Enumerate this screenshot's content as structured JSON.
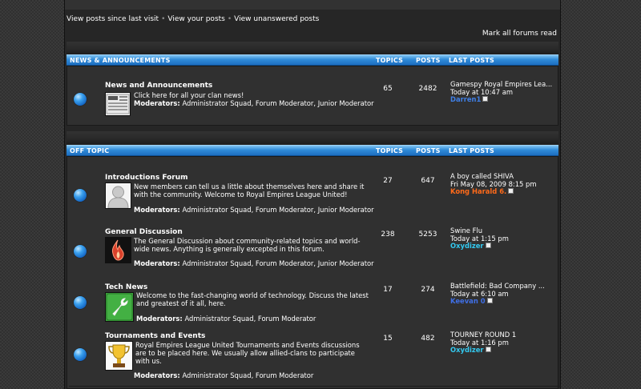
{
  "quicklinks": [
    "View posts since last visit",
    "View your posts",
    "View unanswered posts"
  ],
  "separator": "•",
  "mark_all": "Mark all forums read",
  "columns": {
    "topics": "TOPICS",
    "posts": "POSTS",
    "last_posts": "LAST POSTS"
  },
  "categories": [
    {
      "name": "NEWS & ANNOUNCEMENTS",
      "forums": [
        {
          "title": "News and Announcements",
          "desc": "Click here for all your clan news!",
          "mods_label": "Moderators:",
          "mods": "Administrator Squad, Forum Moderator, Junior Moderator",
          "topics": "65",
          "posts": "2482",
          "last_title": "Gamespy Royal Empires Lea...",
          "last_time": "Today at 10:47 am",
          "last_user": "Darren1",
          "last_user_color": "#3f7fe6",
          "icon": "newspaper-icon"
        }
      ]
    },
    {
      "name": "OFF TOPIC",
      "forums": [
        {
          "title": "Introductions Forum",
          "desc": "New members can tell us a little about themselves here and share it with the community. Welcome to Royal Empires League United!",
          "mods_label": "Moderators:",
          "mods": "Administrator Squad, Forum Moderator, Junior Moderator",
          "topics": "27",
          "posts": "647",
          "last_title": "A boy called SHIVA",
          "last_time": "Fri May 08, 2009 8:15 pm",
          "last_user": "Kong Harald 6.",
          "last_user_color": "#ff6a1a",
          "icon": "person-silhouette-icon"
        },
        {
          "title": "General Discussion",
          "desc": "The General Discussion about community-related topics and world-wide news. Anything is generally excepted in this forum.",
          "mods_label": "Moderators:",
          "mods": "Administrator Squad, Forum Moderator, Junior Moderator",
          "topics": "238",
          "posts": "5253",
          "last_title": "Swine Flu",
          "last_time": "Today at 1:15 pm",
          "last_user": "Oxydizer",
          "last_user_color": "#33c9f0",
          "icon": "flame-icon"
        },
        {
          "title": "Tech News",
          "desc": "Welcome to the fast-changing world of technology. Discuss the latest and greatest of it all, here.",
          "mods_label": "Moderators:",
          "mods": "Administrator Squad, Forum Moderator",
          "topics": "17",
          "posts": "274",
          "last_title": "Battlefield: Bad Company ...",
          "last_time": "Today at 6:10 am",
          "last_user": "Keevan 0",
          "last_user_color": "#3f6fe6",
          "icon": "wrench-icon"
        },
        {
          "title": "Tournaments and Events",
          "desc": "Royal Empires League United Tournaments and Events discussions are to be placed here. We usually allow allied-clans to participate with us.",
          "mods_label": "Moderators:",
          "mods": "Administrator Squad, Forum Moderator",
          "topics": "15",
          "posts": "482",
          "last_title": "TOURNEY ROUND 1",
          "last_time": "Today at 1:16 pm",
          "last_user": "Oxydizer",
          "last_user_color": "#33c9f0",
          "icon": "trophy-icon"
        }
      ]
    }
  ]
}
